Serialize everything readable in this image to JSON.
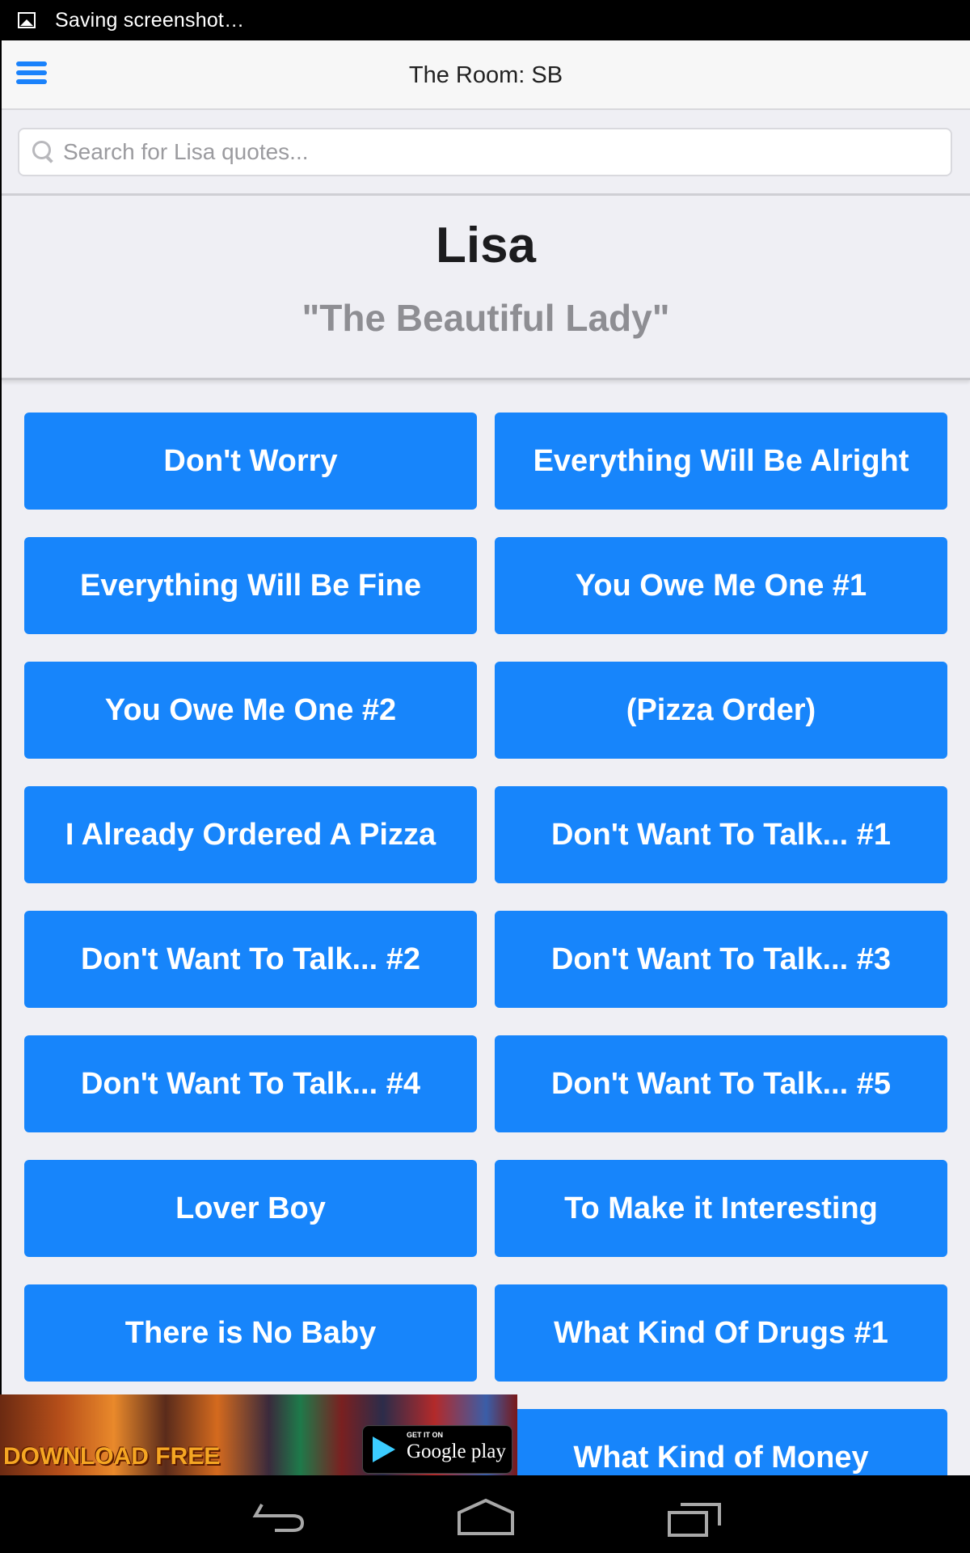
{
  "status_bar": {
    "notification_icon": "image-icon",
    "text": "Saving screenshot…"
  },
  "navbar": {
    "menu_icon": "hamburger-menu-icon",
    "title": "The Room: SB"
  },
  "search": {
    "icon": "search-icon",
    "placeholder": "Search for Lisa quotes...",
    "value": ""
  },
  "header": {
    "name": "Lisa",
    "subtitle": "\"The Beautiful Lady\""
  },
  "quotes": [
    "Don't Worry",
    "Everything Will Be Alright",
    "Everything Will Be Fine",
    "You Owe Me One #1",
    "You Owe Me One #2",
    "(Pizza Order)",
    "I Already Ordered A Pizza",
    "Don't Want To Talk... #1",
    "Don't Want To Talk... #2",
    "Don't Want To Talk... #3",
    "Don't Want To Talk... #4",
    "Don't Want To Talk... #5",
    "Lover Boy",
    "To Make it Interesting",
    "There is No Baby",
    "What Kind Of Drugs #1",
    "",
    "What Kind of Money"
  ],
  "ad": {
    "headline": "DOWNLOAD FREE",
    "store_small": "GET IT ON",
    "store_big": "Google play"
  },
  "system_nav": {
    "back": "back-icon",
    "home": "home-icon",
    "recents": "recents-icon"
  },
  "colors": {
    "accent": "#1785fb",
    "background": "#efeff4",
    "subtitle": "#8e8e93"
  }
}
